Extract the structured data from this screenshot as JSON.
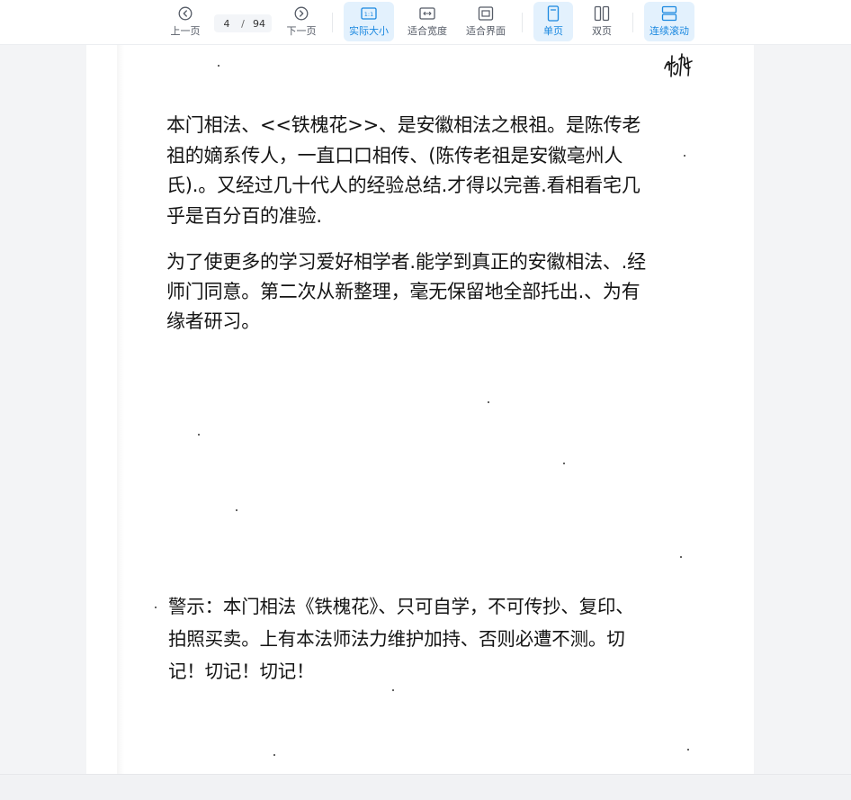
{
  "toolbar": {
    "prev_label": "上一页",
    "next_label": "下一页",
    "current_page": "4",
    "page_separator": "/",
    "total_pages": "94",
    "actual_size_label": "实际大小",
    "fit_width_label": "适合宽度",
    "fit_page_label": "适合界面",
    "single_page_label": "单页",
    "double_page_label": "双页",
    "continuous_label": "连续滚动",
    "accent_color": "#1a88e0",
    "active_bg_color": "#e3f1fd"
  },
  "document": {
    "paragraph1": "本门相法、<<铁槐花>>、是安徽相法之根祖。是陈传老祖的嫡系传人，一直口口相传、(陈传老祖是安徽亳州人氏).。又经过几十代人的经验总结.才得以完善.看相看宅几乎是百分百的准验.",
    "paragraph2": "为了使更多的学习爱好相学者.能学到真正的安徽相法、.经师门同意。第二次从新整理，毫无保留地全部托出.、为有缘者研习。",
    "warning": "警示：本门相法《铁槐花》、只可自学，不可传抄、复印、拍照买卖。上有本法师法力维护加持、否则必遭不测。切记！切记！切记！",
    "signature_icon": "handwritten-signature"
  }
}
